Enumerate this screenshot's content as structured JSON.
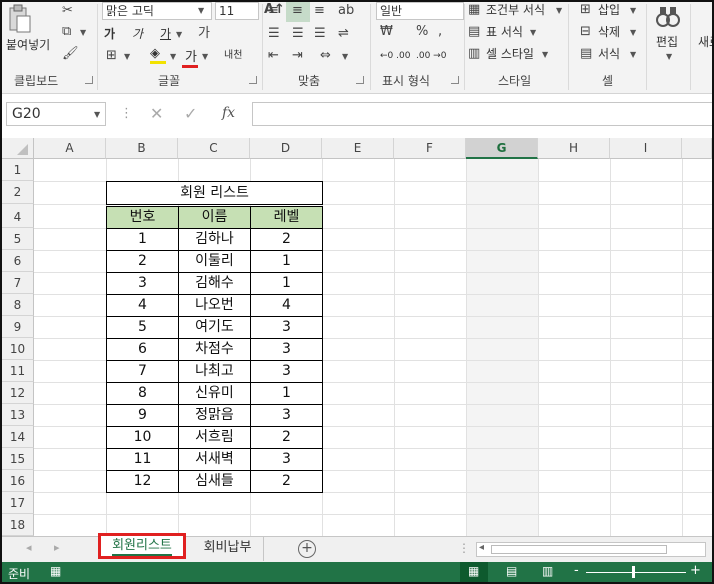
{
  "ribbon": {
    "clipboard": {
      "paste": "붙여넣기",
      "label": "클립보드"
    },
    "font": {
      "name": "맑은 고딕",
      "size": "11",
      "label": "글꼴",
      "bold_text": "가",
      "phonetic": "내천"
    },
    "alignment": {
      "label": "맞춤"
    },
    "number": {
      "format": "일반",
      "label": "표시 형식"
    },
    "styles": {
      "conditional": "조건부 서식",
      "table": "표 서식",
      "cell_styles": "셀 스타일",
      "label": "스타일"
    },
    "cells": {
      "insert": "삽입",
      "delete": "삭제",
      "format": "서식",
      "label": "셀"
    },
    "editing": {
      "label": "편집"
    },
    "extra": {
      "label": "새로"
    }
  },
  "formula_bar": {
    "name_box": "G20",
    "fx": "fx",
    "value": ""
  },
  "grid": {
    "columns": [
      "A",
      "B",
      "C",
      "D",
      "E",
      "F",
      "G",
      "H",
      "I"
    ],
    "selected_column": "G",
    "rows": [
      "1",
      "2",
      "4",
      "5",
      "6",
      "7",
      "8",
      "9",
      "10",
      "11",
      "12",
      "13",
      "14",
      "15",
      "16",
      "17",
      "18"
    ]
  },
  "table": {
    "title": "회원 리스트",
    "headers": [
      "번호",
      "이름",
      "레벨"
    ],
    "rows": [
      [
        "1",
        "김하나",
        "2"
      ],
      [
        "2",
        "이둘리",
        "1"
      ],
      [
        "3",
        "김해수",
        "1"
      ],
      [
        "4",
        "나오번",
        "4"
      ],
      [
        "5",
        "여기도",
        "3"
      ],
      [
        "6",
        "차점수",
        "3"
      ],
      [
        "7",
        "나최고",
        "3"
      ],
      [
        "8",
        "신유미",
        "1"
      ],
      [
        "9",
        "정맑음",
        "3"
      ],
      [
        "10",
        "서흐림",
        "2"
      ],
      [
        "11",
        "서새벽",
        "3"
      ],
      [
        "12",
        "심새들",
        "2"
      ]
    ]
  },
  "sheets": {
    "tabs": [
      "회원리스트",
      "회비납부"
    ],
    "active": "회원리스트"
  },
  "status": {
    "ready": "준비",
    "zoom_minus": "-",
    "zoom_plus": "+"
  },
  "colors": {
    "accent": "#217346",
    "header_fill": "#c6e0b4",
    "highlight": "#e02020"
  }
}
